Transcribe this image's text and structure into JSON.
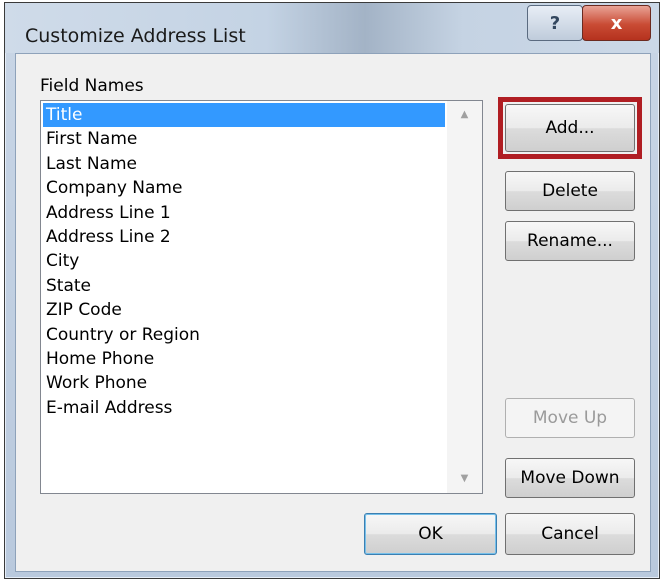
{
  "window": {
    "title": "Customize Address List",
    "help_glyph": "?",
    "close_glyph": "x"
  },
  "field_names_label": "Field Names",
  "fields": [
    "Title",
    "First Name",
    "Last Name",
    "Company Name",
    "Address Line 1",
    "Address Line 2",
    "City",
    "State",
    "ZIP Code",
    "Country or Region",
    "Home Phone",
    "Work Phone",
    "E-mail Address"
  ],
  "selected_field": "Title",
  "buttons": {
    "add": "Add...",
    "delete": "Delete",
    "rename": "Rename...",
    "move_up": "Move Up",
    "move_down": "Move Down",
    "ok": "OK",
    "cancel": "Cancel"
  },
  "scroll_up_glyph": "▲",
  "scroll_down_glyph": "▼",
  "colors": {
    "selection": "#3399ff",
    "highlight_box": "#b01e23",
    "close_button": "#c94b34"
  }
}
